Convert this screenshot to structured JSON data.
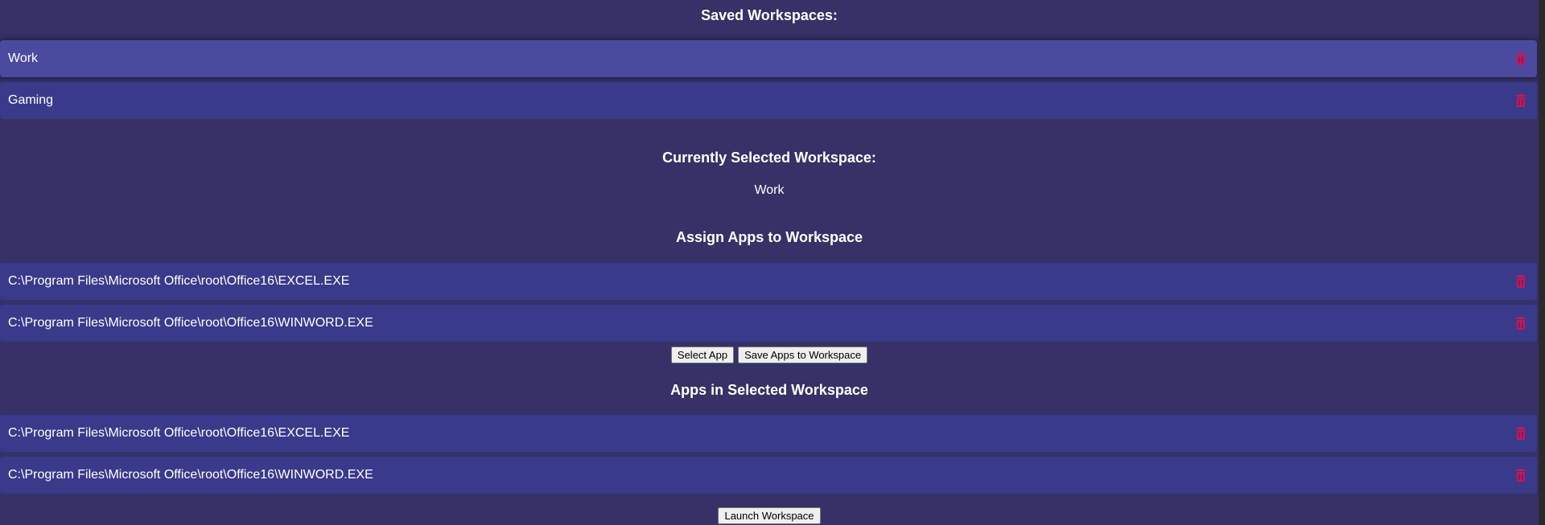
{
  "saved_workspaces": {
    "heading": "Saved Workspaces:",
    "items": [
      {
        "label": "Work",
        "selected": true
      },
      {
        "label": "Gaming",
        "selected": false
      }
    ]
  },
  "current": {
    "heading": "Currently Selected Workspace:",
    "name": "Work"
  },
  "assign": {
    "heading": "Assign Apps to Workspace",
    "items": [
      {
        "label": "C:\\Program Files\\Microsoft Office\\root\\Office16\\EXCEL.EXE"
      },
      {
        "label": "C:\\Program Files\\Microsoft Office\\root\\Office16\\WINWORD.EXE"
      }
    ],
    "select_app_label": "Select App",
    "save_apps_label": "Save Apps to Workspace"
  },
  "apps_in_workspace": {
    "heading": "Apps in Selected Workspace",
    "items": [
      {
        "label": "C:\\Program Files\\Microsoft Office\\root\\Office16\\EXCEL.EXE"
      },
      {
        "label": "C:\\Program Files\\Microsoft Office\\root\\Office16\\WINWORD.EXE"
      }
    ],
    "launch_label": "Launch Workspace"
  },
  "icons": {
    "delete": "trash-icon"
  },
  "colors": {
    "background": "#363166",
    "row": "#393a8a",
    "row_selected": "#4a4a9e",
    "trash": "#c2185b"
  }
}
